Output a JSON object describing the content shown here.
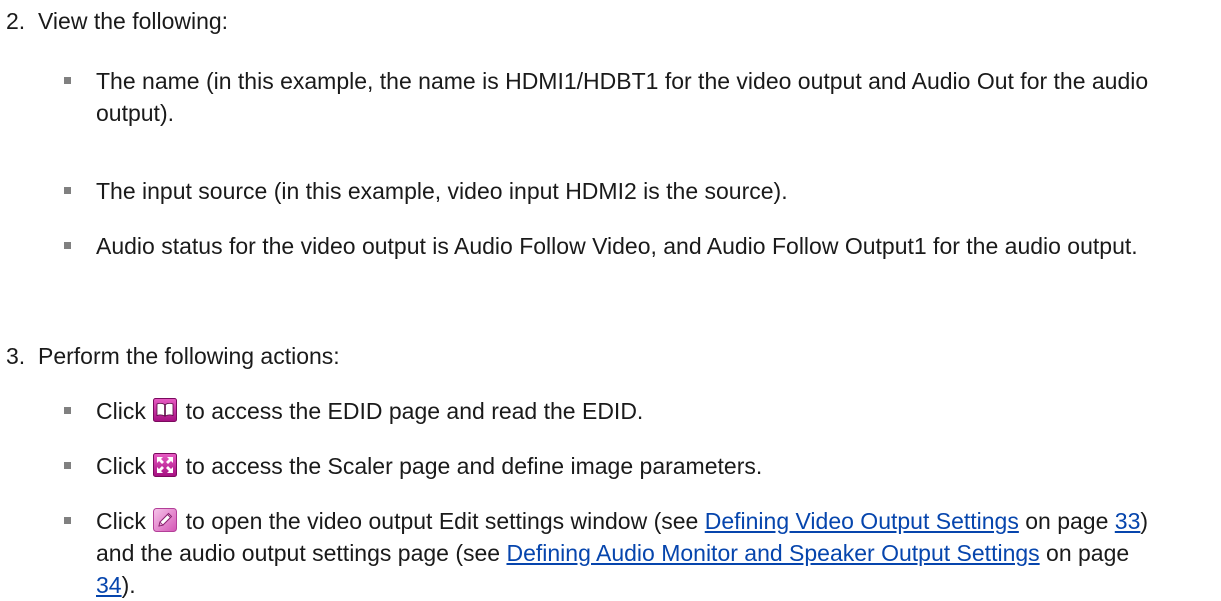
{
  "step2": {
    "number": "2.",
    "heading": "View the following:",
    "bullets": [
      "The name (in this example, the name is HDMI1/HDBT1 for the video output and Audio Out for the audio output).",
      "The input source (in this example, video input HDMI2 is the source).",
      "Audio status for the video output is Audio Follow Video, and Audio Follow Output1 for the audio output."
    ]
  },
  "step3": {
    "number": "3.",
    "heading": "Perform the following actions:",
    "edid": {
      "click": "Click",
      "icon": "book-icon",
      "text": "to access the EDID page and read the EDID."
    },
    "scaler": {
      "click": "Click",
      "icon": "scaler-icon",
      "text": "to access the Scaler page and define image parameters."
    },
    "edit": {
      "click": "Click",
      "icon": "edit-pencil-icon",
      "text1": "to open the video output Edit settings window (see",
      "link1": "Defining Video Output Settings",
      "text2": "on page",
      "page1": "33",
      "text3": ") and the audio output settings page (see",
      "link2": "Defining Audio Monitor and Speaker Output Settings",
      "text4": "on page",
      "page2": "34",
      "text5": ")."
    }
  },
  "colors": {
    "text": "#1a1a1a",
    "bullet": "#808080",
    "link": "#0645ad",
    "icon": "#c2189b"
  }
}
